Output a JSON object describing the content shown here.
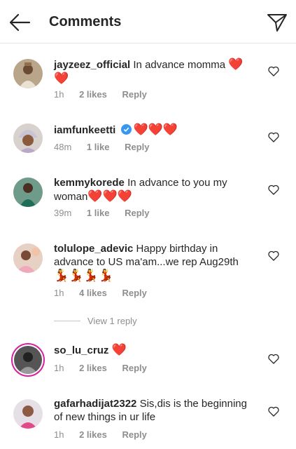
{
  "header": {
    "title": "Comments",
    "back_icon": "arrow-left-icon",
    "share_icon": "paper-plane-icon"
  },
  "comments": [
    {
      "username": "jayzeez_official",
      "text": "In advance momma ",
      "emoji": "❤️❤️",
      "time": "1h",
      "likes": "2 likes",
      "reply": "Reply"
    },
    {
      "username": "iamfunkeetti",
      "text": "",
      "emoji": "❤️❤️❤️",
      "verified": true,
      "time": "48m",
      "likes": "1 like",
      "reply": "Reply"
    },
    {
      "username": "kemmykorede",
      "text": "In advance to you my woman",
      "emoji": "❤️❤️❤️",
      "time": "39m",
      "likes": "1 like",
      "reply": "Reply"
    },
    {
      "username": "tolulope_adevic",
      "text": "Happy birthday in advance to US ma'am...we rep Aug29th",
      "emoji": "💃💃💃💃",
      "time": "1h",
      "likes": "4 likes",
      "reply": "Reply"
    },
    {
      "username": "so_lu_cruz",
      "text": "",
      "emoji": "❤️",
      "time": "1h",
      "likes": "2 likes",
      "reply": "Reply"
    },
    {
      "username": "gafarhadijat2322",
      "text": "Sis,dis is the beginning of new things in ur life",
      "emoji": "",
      "time": "1h",
      "likes": "2 likes",
      "reply": "Reply"
    }
  ],
  "view_replies": "View 1 reply",
  "colors": {
    "heart": "#d61e2b",
    "meta": "#8e8e8e",
    "verified": "#3897f0"
  }
}
